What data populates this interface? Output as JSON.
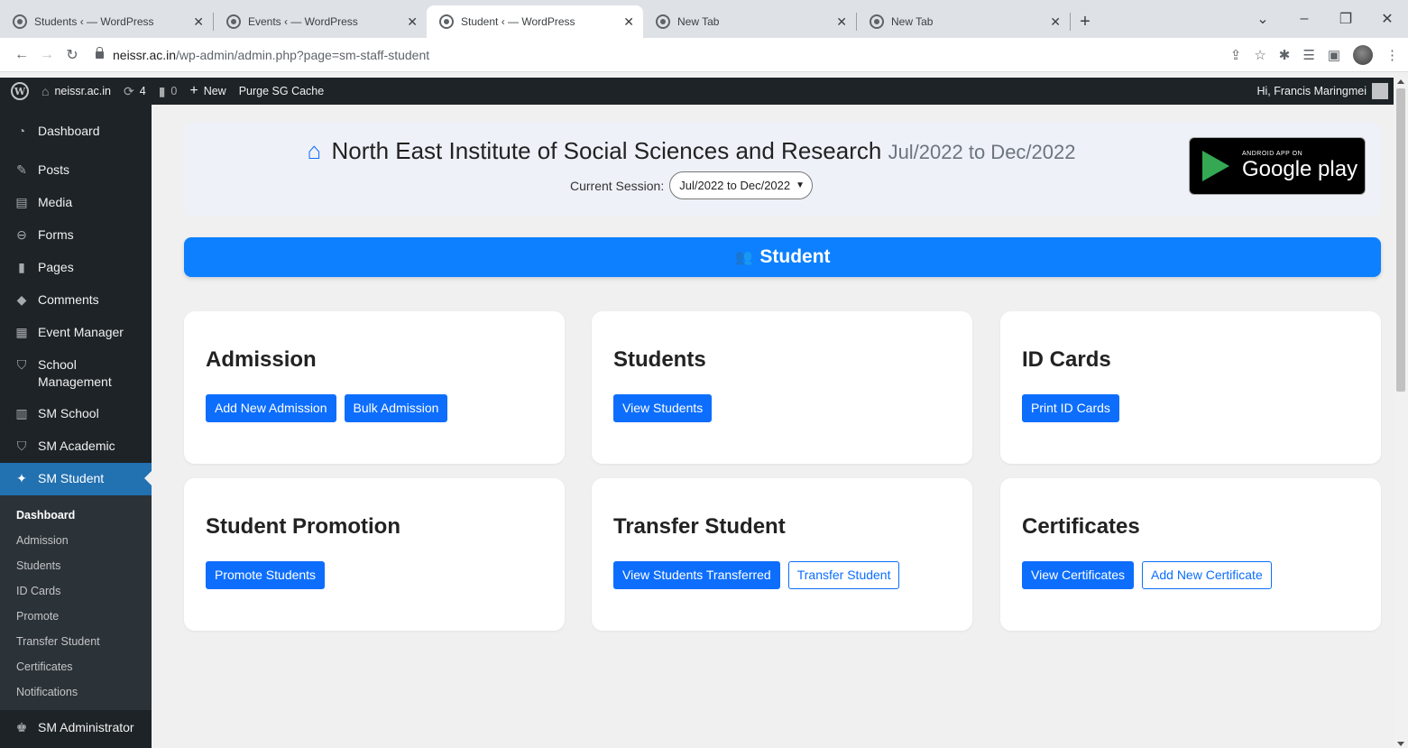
{
  "browser": {
    "tabs": [
      {
        "title": "Students ‹ — WordPress",
        "active": false
      },
      {
        "title": "Events ‹ — WordPress",
        "active": false
      },
      {
        "title": "Student ‹ — WordPress",
        "active": true
      },
      {
        "title": "New Tab",
        "active": false
      },
      {
        "title": "New Tab",
        "active": false
      }
    ],
    "url_host": "neissr.ac.in",
    "url_path": "/wp-admin/admin.php?page=sm-staff-student"
  },
  "adminbar": {
    "site_name": "neissr.ac.in",
    "updates_count": "4",
    "comments_count": "0",
    "new_label": "New",
    "purge_label": "Purge SG Cache",
    "greeting": "Hi, Francis Maringmei"
  },
  "sidebar": {
    "items": [
      {
        "label": "Dashboard",
        "icon": "dashboard-icon"
      },
      {
        "label": "Posts",
        "icon": "pin-icon"
      },
      {
        "label": "Media",
        "icon": "media-icon"
      },
      {
        "label": "Forms",
        "icon": "forms-icon"
      },
      {
        "label": "Pages",
        "icon": "pages-icon"
      },
      {
        "label": "Comments",
        "icon": "comment-icon"
      },
      {
        "label": "Event Manager",
        "icon": "calendar-icon"
      },
      {
        "label": "School Management",
        "icon": "graduation-cap-icon"
      },
      {
        "label": "SM School",
        "icon": "building-icon"
      },
      {
        "label": "SM Academic",
        "icon": "graduation-cap-icon"
      },
      {
        "label": "SM Student",
        "icon": "students-icon"
      }
    ],
    "submenu": [
      "Dashboard",
      "Admission",
      "Students",
      "ID Cards",
      "Promote",
      "Transfer Student",
      "Certificates",
      "Notifications"
    ],
    "after": {
      "label": "SM Administrator",
      "icon": "admin-icon"
    }
  },
  "header": {
    "institute_name": "North East Institute of Social Sciences and Research",
    "session_title": "Jul/2022 to Dec/2022",
    "current_session_label": "Current Session:",
    "session_selected": "Jul/2022 to Dec/2022",
    "gplay_small": "ANDROID APP ON",
    "gplay_big": "Google play"
  },
  "banner": {
    "title": "Student"
  },
  "cards": {
    "admission": {
      "title": "Admission",
      "btn1": "Add New Admission",
      "btn2": "Bulk Admission"
    },
    "students": {
      "title": "Students",
      "btn1": "View Students"
    },
    "idcards": {
      "title": "ID Cards",
      "btn1": "Print ID Cards"
    },
    "promotion": {
      "title": "Student Promotion",
      "btn1": "Promote Students"
    },
    "transfer": {
      "title": "Transfer Student",
      "btn1": "View Students Transferred",
      "btn2": "Transfer Student"
    },
    "certificates": {
      "title": "Certificates",
      "btn1": "View Certificates",
      "btn2": "Add New Certificate"
    }
  }
}
